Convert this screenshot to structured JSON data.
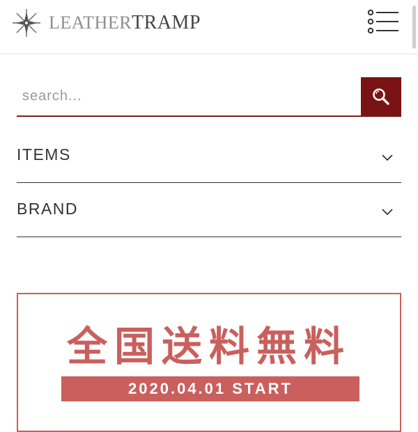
{
  "header": {
    "logo_text_light": "LEATHER",
    "logo_text_bold": "TRAMP",
    "logo_icon": "compass-star-logo",
    "menu_icon": "list-menu-icon"
  },
  "search": {
    "placeholder": "search...",
    "value": "",
    "icon": "search-icon",
    "accent_color": "#7a1414"
  },
  "accordion": [
    {
      "label": "ITEMS",
      "icon": "chevron-down-icon"
    },
    {
      "label": "BRAND",
      "icon": "chevron-down-icon"
    }
  ],
  "banner": {
    "title": "全国送料無料",
    "subtitle": "2020.04.01 START",
    "color": "#c9605d"
  }
}
